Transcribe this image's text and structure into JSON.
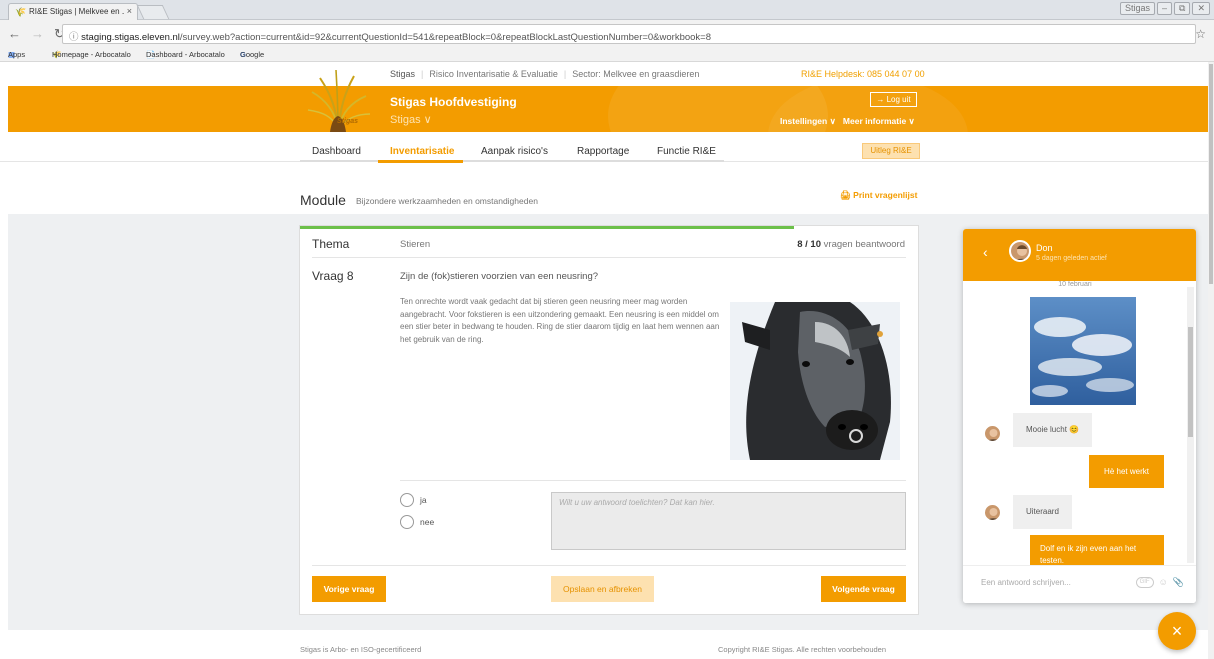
{
  "browser": {
    "tab_title": "RI&E Stigas | Melkvee en ․",
    "tab_close": "×",
    "window_user": "Stigas",
    "window_controls": [
      "–",
      "⧉",
      "✕"
    ],
    "url_host": "staging.stigas.eleven.nl",
    "url_path": "/survey.web?action=current&id=92&currentQuestionId=541&repeatBlock=0&repeatBlockLastQuestionNumber=0&workbook=8",
    "bookmarks": [
      "Apps",
      "Homepage - Arbocatalo",
      "Dashboard - Arbocatalo",
      "Google"
    ]
  },
  "site": {
    "logo_text": "Stigas",
    "topline_brand": "Stigas",
    "topline_product": "Risico Inventarisatie & Evaluatie",
    "topline_sector": "Sector: Melkvee en graasdieren",
    "helpdesk": "RI&E Helpdesk: 085 044 07 00",
    "org_name": "Stigas Hoofdvestiging",
    "org_switch": "Stigas ∨",
    "logout": "→ Log uit",
    "menu_settings": "Instellingen ∨",
    "menu_more": "Meer informatie ∨"
  },
  "nav": {
    "tabs": [
      "Dashboard",
      "Inventarisatie",
      "Aanpak risico's",
      "Rapportage",
      "Functie RI&E"
    ],
    "active": "Inventarisatie",
    "uitleg": "Uitleg RI&E"
  },
  "module": {
    "title": "Module",
    "subtitle": "Bijzondere werkzaamheden en omstandigheden",
    "print": "Print vragenlijst"
  },
  "question": {
    "thema_label": "Thema",
    "thema_value": "Stieren",
    "answered_count": "8 / 10",
    "answered_suffix": " vragen beantwoord",
    "progress_fraction": 0.8,
    "vraag_label": "Vraag 8",
    "vraag_text": "Zijn de (fok)stieren voorzien van een neusring?",
    "explanation": "Ten onrechte wordt vaak gedacht dat bij stieren geen neusring meer mag worden aangebracht. Voor fokstieren is een uitzondering gemaakt. Een neusring is een middel om een stier beter in bedwang te houden. Ring de stier daarom tijdig en laat hem wennen aan het gebruik van de ring.",
    "options": [
      "ja",
      "nee"
    ],
    "answer_placeholder": "Wilt u uw antwoord toelichten? Dat kan hier.",
    "btn_prev": "Vorige vraag",
    "btn_save": "Opslaan en afbreken",
    "btn_next": "Volgende vraag"
  },
  "footer": {
    "left": "Stigas is Arbo- en ISO-gecertificeerd",
    "right": "Copyright RI&E Stigas. Alle rechten voorbehouden"
  },
  "chat": {
    "name": "Don",
    "status": "5 dagen geleden actief",
    "date": "10 februari",
    "messages": {
      "in1": "Mooie lucht 😊",
      "out1": "Hè het werkt",
      "in2": "Uiteraard",
      "out2": "Dolf en ik zijn even aan het testen."
    },
    "input_placeholder": "Een antwoord schrijven...",
    "gif": "GIF"
  },
  "fab_icon": "×",
  "colors": {
    "accent": "#f39c00",
    "progress": "#6cc04a"
  }
}
